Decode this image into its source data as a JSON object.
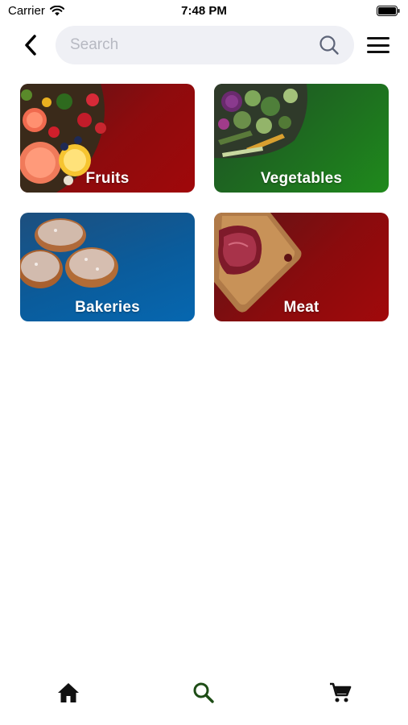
{
  "status_bar": {
    "carrier": "Carrier",
    "time": "7:48 PM"
  },
  "header": {
    "search_placeholder": "Search",
    "search_value": ""
  },
  "categories": [
    {
      "label": "Fruits",
      "color": "#8e0b0d"
    },
    {
      "label": "Vegetables",
      "color": "#1e6b20"
    },
    {
      "label": "Bakeries",
      "color": "#0a5c9c"
    },
    {
      "label": "Meat",
      "color": "#8a0b0d"
    }
  ],
  "bottom_nav": {
    "items": [
      {
        "icon": "home-icon",
        "color": "#111111"
      },
      {
        "icon": "search-icon",
        "color": "#1e4d16",
        "active": true
      },
      {
        "icon": "cart-icon",
        "color": "#111111"
      }
    ]
  }
}
